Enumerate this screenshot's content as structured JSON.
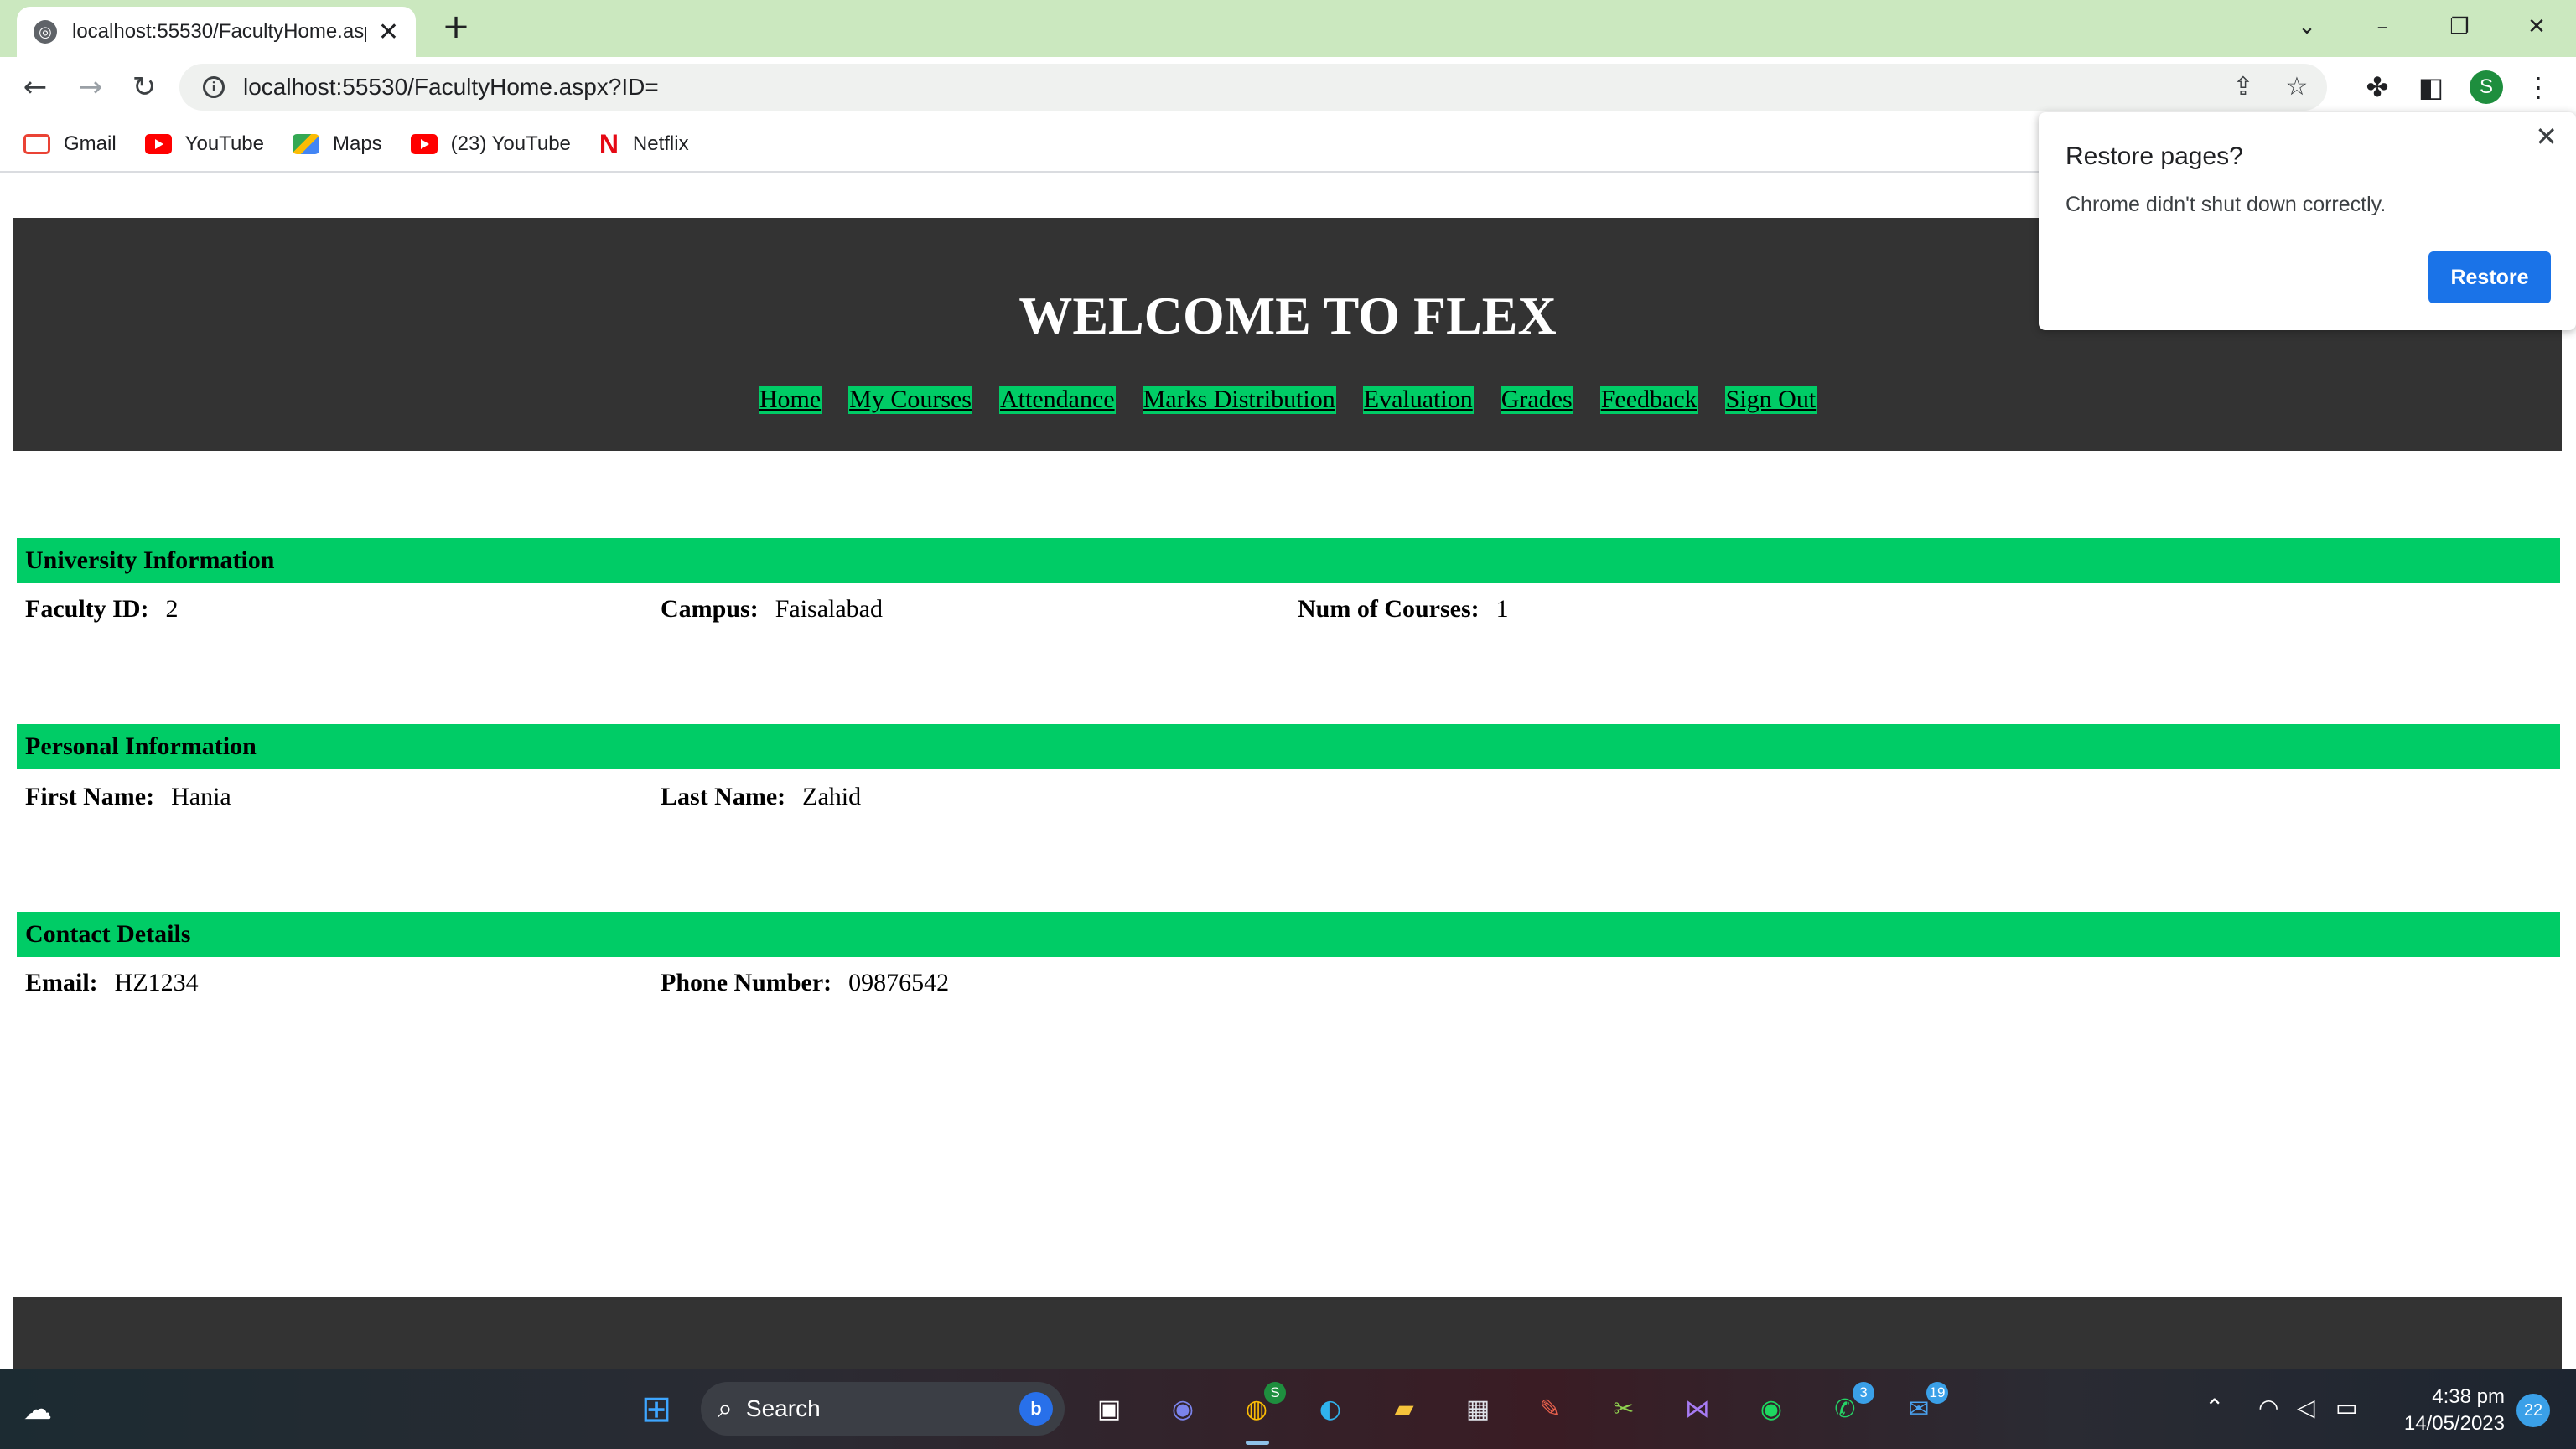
{
  "browser": {
    "tab_title": "localhost:55530/FacultyHome.asp",
    "url": "localhost:55530/FacultyHome.aspx?ID=",
    "profile_initial": "S",
    "bookmarks": [
      {
        "label": "Gmail",
        "icon": "gmail-icon"
      },
      {
        "label": "YouTube",
        "icon": "youtube-icon"
      },
      {
        "label": "Maps",
        "icon": "maps-icon"
      },
      {
        "label": "(23) YouTube",
        "icon": "youtube-icon"
      },
      {
        "label": "Netflix",
        "icon": "netflix-icon"
      }
    ]
  },
  "restore_popup": {
    "title": "Restore pages?",
    "message": "Chrome didn't shut down correctly.",
    "button": "Restore"
  },
  "site": {
    "title": "WELCOME TO FLEX",
    "nav": [
      "Home",
      "My Courses",
      "Attendance",
      "Marks Distribution",
      "Evaluation",
      "Grades",
      "Feedback",
      "Sign Out"
    ],
    "accent_color": "#00cc66",
    "header_color": "#333333"
  },
  "sections": {
    "university": {
      "title": "University Information",
      "faculty_id_label": "Faculty ID:",
      "faculty_id": "2",
      "campus_label": "Campus:",
      "campus": "Faisalabad",
      "courses_label": "Num of Courses:",
      "courses": "1"
    },
    "personal": {
      "title": "Personal Information",
      "first_name_label": "First Name:",
      "first_name": "Hania",
      "last_name_label": "Last Name:",
      "last_name": "Zahid"
    },
    "contact": {
      "title": "Contact Details",
      "email_label": "Email:",
      "email": "HZ1234",
      "phone_label": "Phone Number:",
      "phone": "09876542"
    }
  },
  "taskbar": {
    "search_placeholder": "Search",
    "chrome_badge": "S",
    "whatsapp_badge": "3",
    "mail_badge": "19",
    "time": "4:38 pm",
    "date": "14/05/2023",
    "notification_count": "22"
  }
}
